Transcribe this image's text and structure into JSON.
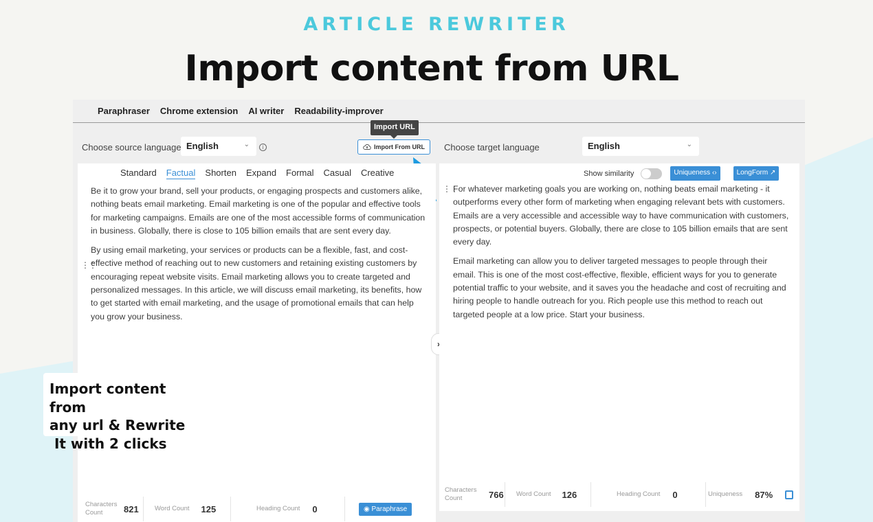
{
  "eyebrow": "ARTICLE REWRITER",
  "title": "Import content from URL",
  "nav": [
    "Paraphraser",
    "Chrome extension",
    "AI writer",
    "Readability-improver"
  ],
  "source": {
    "label": "Choose source language",
    "value": "English"
  },
  "target": {
    "label": "Choose target language",
    "value": "English"
  },
  "import": {
    "tooltip": "Import URL",
    "button": "Import From URL"
  },
  "modes": [
    "Standard",
    "Factual",
    "Shorten",
    "Expand",
    "Formal",
    "Casual",
    "Creative"
  ],
  "active_mode": "Factual",
  "left_text": [
    "Be it to grow your brand, sell your products, or engaging prospects and customers alike, nothing beats email marketing. Email marketing is one of the popular and effective tools for marketing campaigns. Emails are one of the most accessible forms of communication in business. Globally, there is close to 105 billion emails that are sent every day.",
    "By using email marketing, your services or products can be a flexible, fast, and cost-effective method of reaching out to new customers and retaining existing customers by encouraging repeat website visits. Email marketing allows you to create targeted and personalized messages. In this article, we will discuss email marketing, its benefits, how to get started with email marketing, and the usage of promotional emails that can help you grow your business."
  ],
  "right_tools": {
    "similarity": "Show similarity",
    "uniqueness": "Uniqueness",
    "longform": "LongForm"
  },
  "right_text": [
    "For whatever marketing goals you are working on, nothing beats email marketing - it outperforms every other form of marketing when engaging relevant bets with customers. Emails are a very accessible and accessible way to have communication with customers, prospects, or potential buyers. Globally, there are close to 105 billion emails that are sent every day.",
    "Email marketing can allow you to deliver targeted messages to people through their email. This is one of the most cost-effective, flexible, efficient ways for you to generate potential traffic to your website, and it saves you the headache and cost of recruiting and hiring people to handle outreach for you. Rich people use this method to reach out targeted people at a low price. Start your business."
  ],
  "left_stats": {
    "chars_label": "Characters Count",
    "chars": "821",
    "words_label": "Word Count",
    "words": "125",
    "heading_label": "Heading Count",
    "heading": "0",
    "paraphrase": "Paraphrase"
  },
  "right_stats": {
    "chars_label": "Characters Count",
    "chars": "766",
    "words_label": "Word Count",
    "words": "126",
    "heading_label": "Heading Count",
    "heading": "0",
    "uniq_label": "Uniqueness",
    "uniq": "87%"
  },
  "callout": [
    "Import content from",
    "any url & Rewrite",
    " It with 2 clicks"
  ],
  "colors": {
    "accent": "#3a8fd6",
    "eyebrow": "#4cc9dc",
    "arrow": "#1d9be0"
  }
}
